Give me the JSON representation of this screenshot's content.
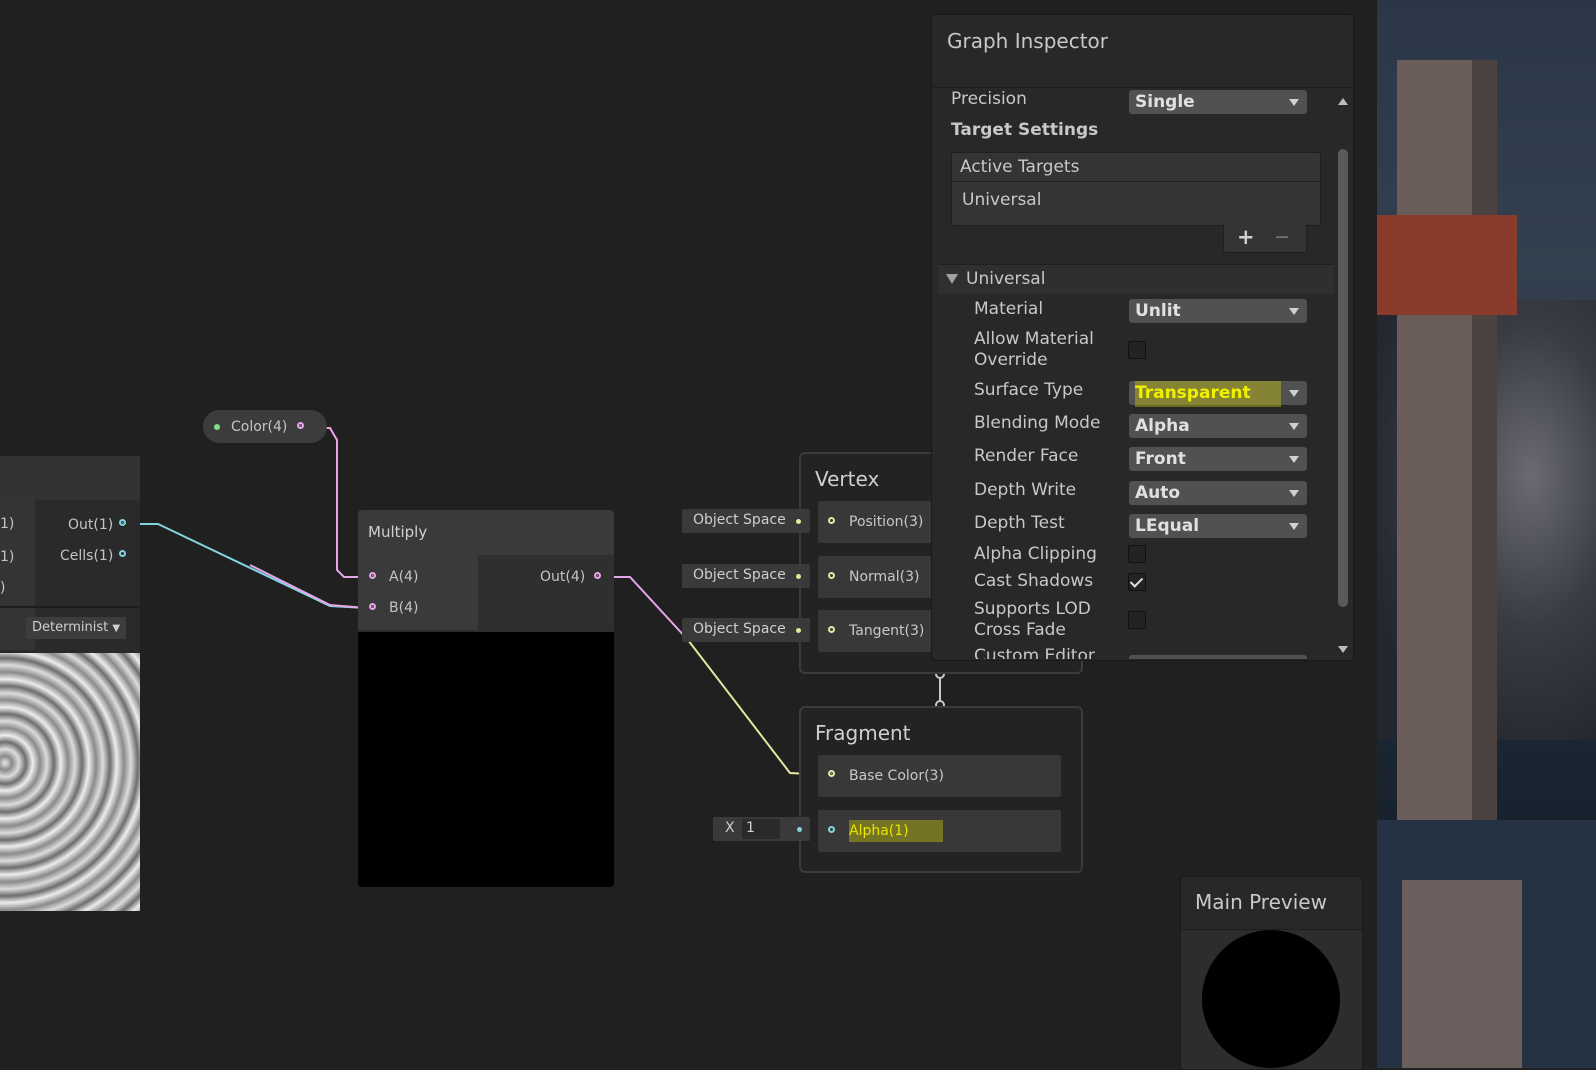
{
  "left_node": {
    "ports": [
      {
        "left": "1)",
        "right": "Out(1)"
      },
      {
        "left": "1)",
        "right": "Cells(1)"
      },
      {
        "left": ")",
        "right": ""
      }
    ],
    "dropdown": "Determinist"
  },
  "color_property": {
    "label": "Color(4)"
  },
  "multiply_node": {
    "title": "Multiply",
    "inputs": [
      "A(4)",
      "B(4)"
    ],
    "output": "Out(4)"
  },
  "vertex": {
    "title": "Vertex",
    "slots": [
      {
        "input": "Object Space",
        "label": "Position(3)"
      },
      {
        "input": "Object Space",
        "label": "Normal(3)"
      },
      {
        "input": "Object Space",
        "label": "Tangent(3)"
      }
    ]
  },
  "fragment": {
    "title": "Fragment",
    "slots": [
      {
        "label": "Base Color(3)"
      },
      {
        "input_prefix": "X",
        "input_value": "1",
        "label": "Alpha(1)"
      }
    ]
  },
  "inspector": {
    "title": "Graph Inspector",
    "precision": {
      "label": "Precision",
      "value": "Single"
    },
    "target_settings": "Target Settings",
    "active_targets": {
      "header": "Active Targets",
      "items": [
        "Universal"
      ],
      "add": "+",
      "remove": "−"
    },
    "universal_section": "Universal",
    "properties": [
      {
        "label": "Material",
        "type": "dropdown",
        "value": "Unlit"
      },
      {
        "label": "Allow Material Override",
        "type": "checkbox",
        "checked": false
      },
      {
        "label": "Surface Type",
        "type": "dropdown",
        "value": "Transparent"
      },
      {
        "label": "Blending Mode",
        "type": "dropdown",
        "value": "Alpha"
      },
      {
        "label": "Render Face",
        "type": "dropdown",
        "value": "Front"
      },
      {
        "label": "Depth Write",
        "type": "dropdown",
        "value": "Auto"
      },
      {
        "label": "Depth Test",
        "type": "dropdown",
        "value": "LEqual"
      },
      {
        "label": "Alpha Clipping",
        "type": "checkbox",
        "checked": false
      },
      {
        "label": "Cast Shadows",
        "type": "checkbox",
        "checked": true
      },
      {
        "label": "Supports LOD Cross Fade",
        "type": "checkbox",
        "checked": false
      },
      {
        "label": "Custom Editor",
        "type": "dropdown",
        "value": ""
      }
    ]
  },
  "main_preview": {
    "title": "Main Preview"
  },
  "colors": {
    "cyan_wire": "#7fd6df",
    "pink_wire": "#e8a6e8",
    "yellow_wire": "#e6e6a0",
    "highlight": "#e6e600"
  }
}
